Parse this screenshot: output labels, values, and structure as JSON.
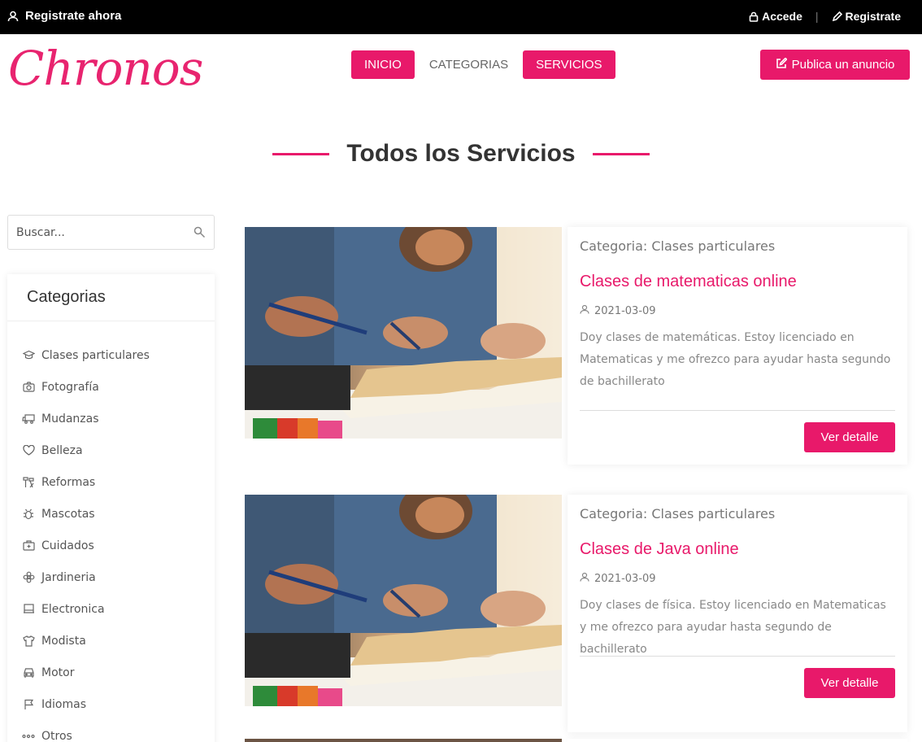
{
  "topbar": {
    "register_now": "Registrate ahora",
    "login": "Accede",
    "separator": "|",
    "register": "Registrate"
  },
  "header": {
    "logo": "Chronos",
    "nav": [
      "INICIO",
      "CATEGORIAS",
      "SERVICIOS"
    ],
    "publish": "Publica un anuncio"
  },
  "section": {
    "title": "Todos los Servicios"
  },
  "search": {
    "placeholder": "Buscar..."
  },
  "categories": {
    "title": "Categorias",
    "items": [
      {
        "label": "Clases particulares",
        "icon": "graduation-cap-icon"
      },
      {
        "label": "Fotografía",
        "icon": "camera-icon"
      },
      {
        "label": "Mudanzas",
        "icon": "truck-icon"
      },
      {
        "label": "Belleza",
        "icon": "heart-icon"
      },
      {
        "label": "Reformas",
        "icon": "tools-icon"
      },
      {
        "label": "Mascotas",
        "icon": "bug-icon"
      },
      {
        "label": "Cuidados",
        "icon": "first-aid-icon"
      },
      {
        "label": "Jardineria",
        "icon": "flower-icon"
      },
      {
        "label": "Electronica",
        "icon": "monitor-icon"
      },
      {
        "label": "Modista",
        "icon": "shirt-icon"
      },
      {
        "label": "Motor",
        "icon": "car-icon"
      },
      {
        "label": "Idiomas",
        "icon": "flag-icon"
      },
      {
        "label": "Otros",
        "icon": "dots-icon"
      }
    ]
  },
  "services": [
    {
      "category": "Categoria: Clases particulares",
      "title": "Clases de matematicas online",
      "date": "2021-03-09",
      "description": "Doy clases de matemáticas. Estoy licenciado en Matematicas y me ofrezco para ayudar hasta segundo de bachillerato",
      "button": "Ver detalle"
    },
    {
      "category": "Categoria: Clases particulares",
      "title": "Clases de Java online",
      "date": "2021-03-09",
      "description": "Doy clases de física. Estoy licenciado en Matematicas y me ofrezco para ayudar hasta segundo de bachillerato",
      "button": "Ver detalle"
    }
  ],
  "colors": {
    "accent": "#e8196a",
    "topbar": "#000000"
  }
}
